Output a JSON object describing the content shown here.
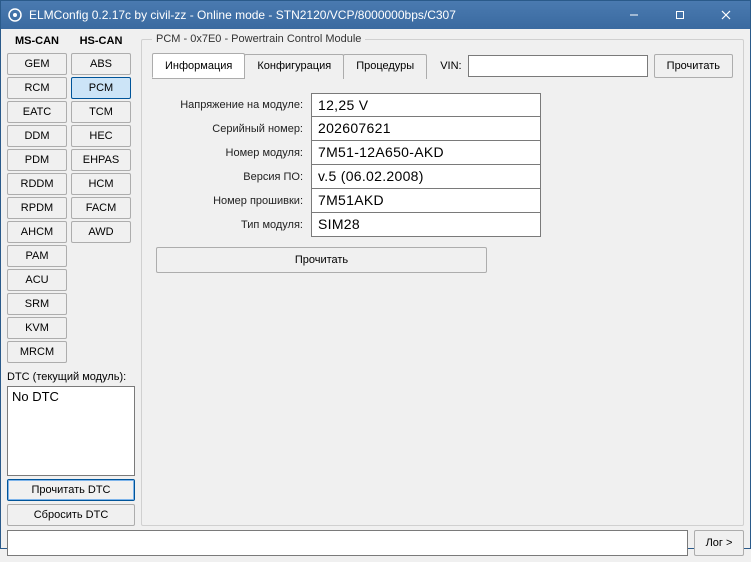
{
  "window": {
    "title": "ELMConfig 0.2.17c by civil-zz - Online mode - STN2120/VCP/8000000bps/C307"
  },
  "modules": {
    "ms_can_header": "MS-CAN",
    "hs_can_header": "HS-CAN",
    "ms_can": [
      "GEM",
      "RCM",
      "EATC",
      "DDM",
      "PDM",
      "RDDM",
      "RPDM",
      "AHCM",
      "PAM",
      "ACU",
      "SRM",
      "KVM",
      "MRCM"
    ],
    "hs_can": [
      "ABS",
      "PCM",
      "TCM",
      "HEC",
      "EHPAS",
      "HCM",
      "FACM",
      "AWD"
    ],
    "selected": "PCM"
  },
  "dtc": {
    "label": "DTC (текущий модуль):",
    "content": "No DTC",
    "read_btn": "Прочитать DTC",
    "reset_btn": "Сбросить DTC"
  },
  "group": {
    "legend": "PCM - 0x7E0 - Powertrain Control Module",
    "tabs": [
      "Информация",
      "Конфигурация",
      "Процедуры"
    ],
    "active_tab": 0,
    "vin_label": "VIN:",
    "vin_value": "",
    "read_vin_btn": "Прочитать"
  },
  "info": {
    "rows": [
      {
        "label": "Напряжение на модуле:",
        "value": "12,25 V"
      },
      {
        "label": "Серийный номер:",
        "value": "202607621"
      },
      {
        "label": "Номер модуля:",
        "value": "7M51-12A650-AKD"
      },
      {
        "label": "Версия ПО:",
        "value": "v.5 (06.02.2008)"
      },
      {
        "label": "Номер прошивки:",
        "value": "7M51AKD"
      },
      {
        "label": "Тип модуля:",
        "value": "SIM28"
      }
    ],
    "read_btn": "Прочитать"
  },
  "bottom": {
    "log_btn": "Лог >"
  }
}
